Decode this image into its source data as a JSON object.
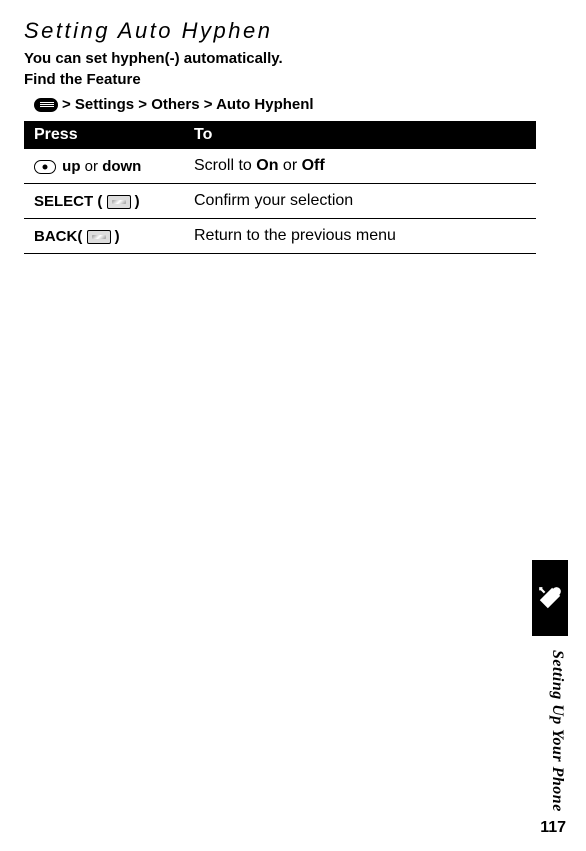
{
  "heading": "Setting Auto Hyphen",
  "subtext": "You can set hyphen(-) automatically.",
  "findFeature": "Find the Feature",
  "breadcrumb": " > Settings > Others > Auto Hyphenl",
  "table": {
    "headers": {
      "press": "Press",
      "to": "To"
    },
    "rows": [
      {
        "press_prefix": "",
        "press_bold1": "up",
        "press_mid": " or ",
        "press_bold2": "down",
        "to_prefix": "Scroll to ",
        "to_bold1": "On",
        "to_mid": " or ",
        "to_bold2": "Off",
        "icon": "nav"
      },
      {
        "press_label": "SELECT ( ",
        "press_suffix": " )",
        "to": "Confirm your selection",
        "icon": "softkey"
      },
      {
        "press_label": "BACK( ",
        "press_suffix": " )",
        "to": "Return to the previous menu",
        "icon": "softkey"
      }
    ]
  },
  "sideText": "Setting Up Your Phone",
  "pageNumber": "117"
}
